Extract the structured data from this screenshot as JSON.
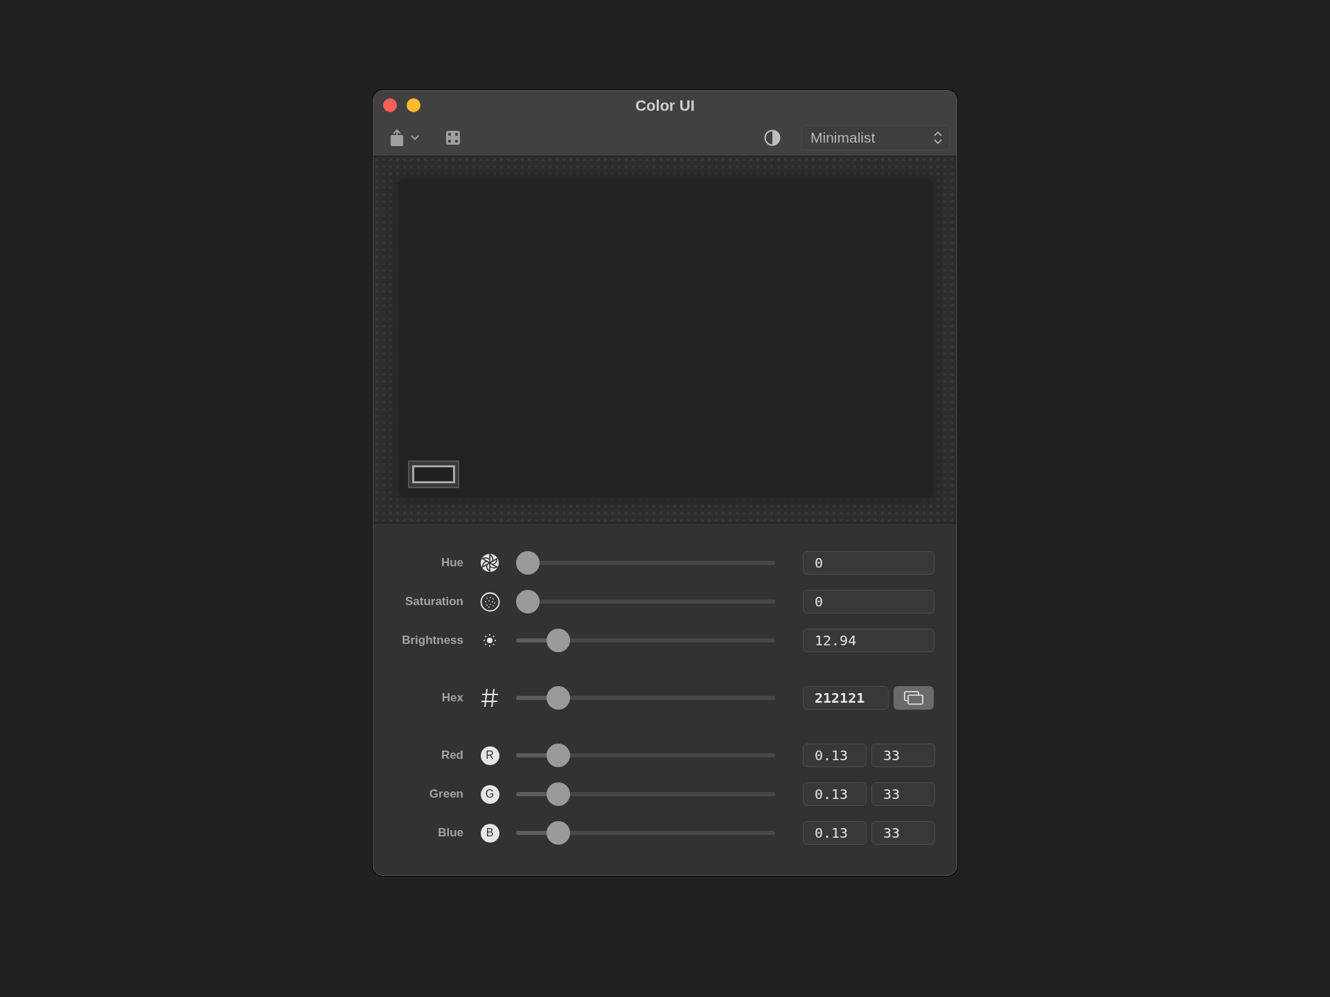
{
  "window": {
    "title": "Color UI",
    "buttons": [
      {
        "kind": "close"
      },
      {
        "kind": "minimize"
      }
    ]
  },
  "toolbar": {
    "share": {
      "has_menu": true
    },
    "style_select": {
      "value": "Minimalist"
    }
  },
  "preview": {
    "swatch": {
      "selected": true
    }
  },
  "control_groups": [
    [
      {
        "kind": "hue",
        "label": "Hue",
        "level": 0,
        "fields": [
          "0"
        ]
      },
      {
        "kind": "saturation",
        "label": "Saturation",
        "level": 0,
        "fields": [
          "0"
        ]
      },
      {
        "kind": "brightness",
        "label": "Brightness",
        "level": 0.13,
        "fields": [
          "12.94"
        ]
      }
    ],
    [
      {
        "kind": "hex",
        "label": "Hex",
        "level": 0.13,
        "fields": [
          "212121"
        ],
        "copy_button": true
      }
    ],
    [
      {
        "kind": "channel",
        "label": "Red",
        "badge": "R",
        "level": 0.13,
        "fields": [
          "0.13",
          "33"
        ]
      },
      {
        "kind": "channel",
        "label": "Green",
        "badge": "G",
        "level": 0.13,
        "fields": [
          "0.13",
          "33"
        ]
      },
      {
        "kind": "channel",
        "label": "Blue",
        "badge": "B",
        "level": 0.13,
        "fields": [
          "0.13",
          "33"
        ]
      }
    ]
  ]
}
